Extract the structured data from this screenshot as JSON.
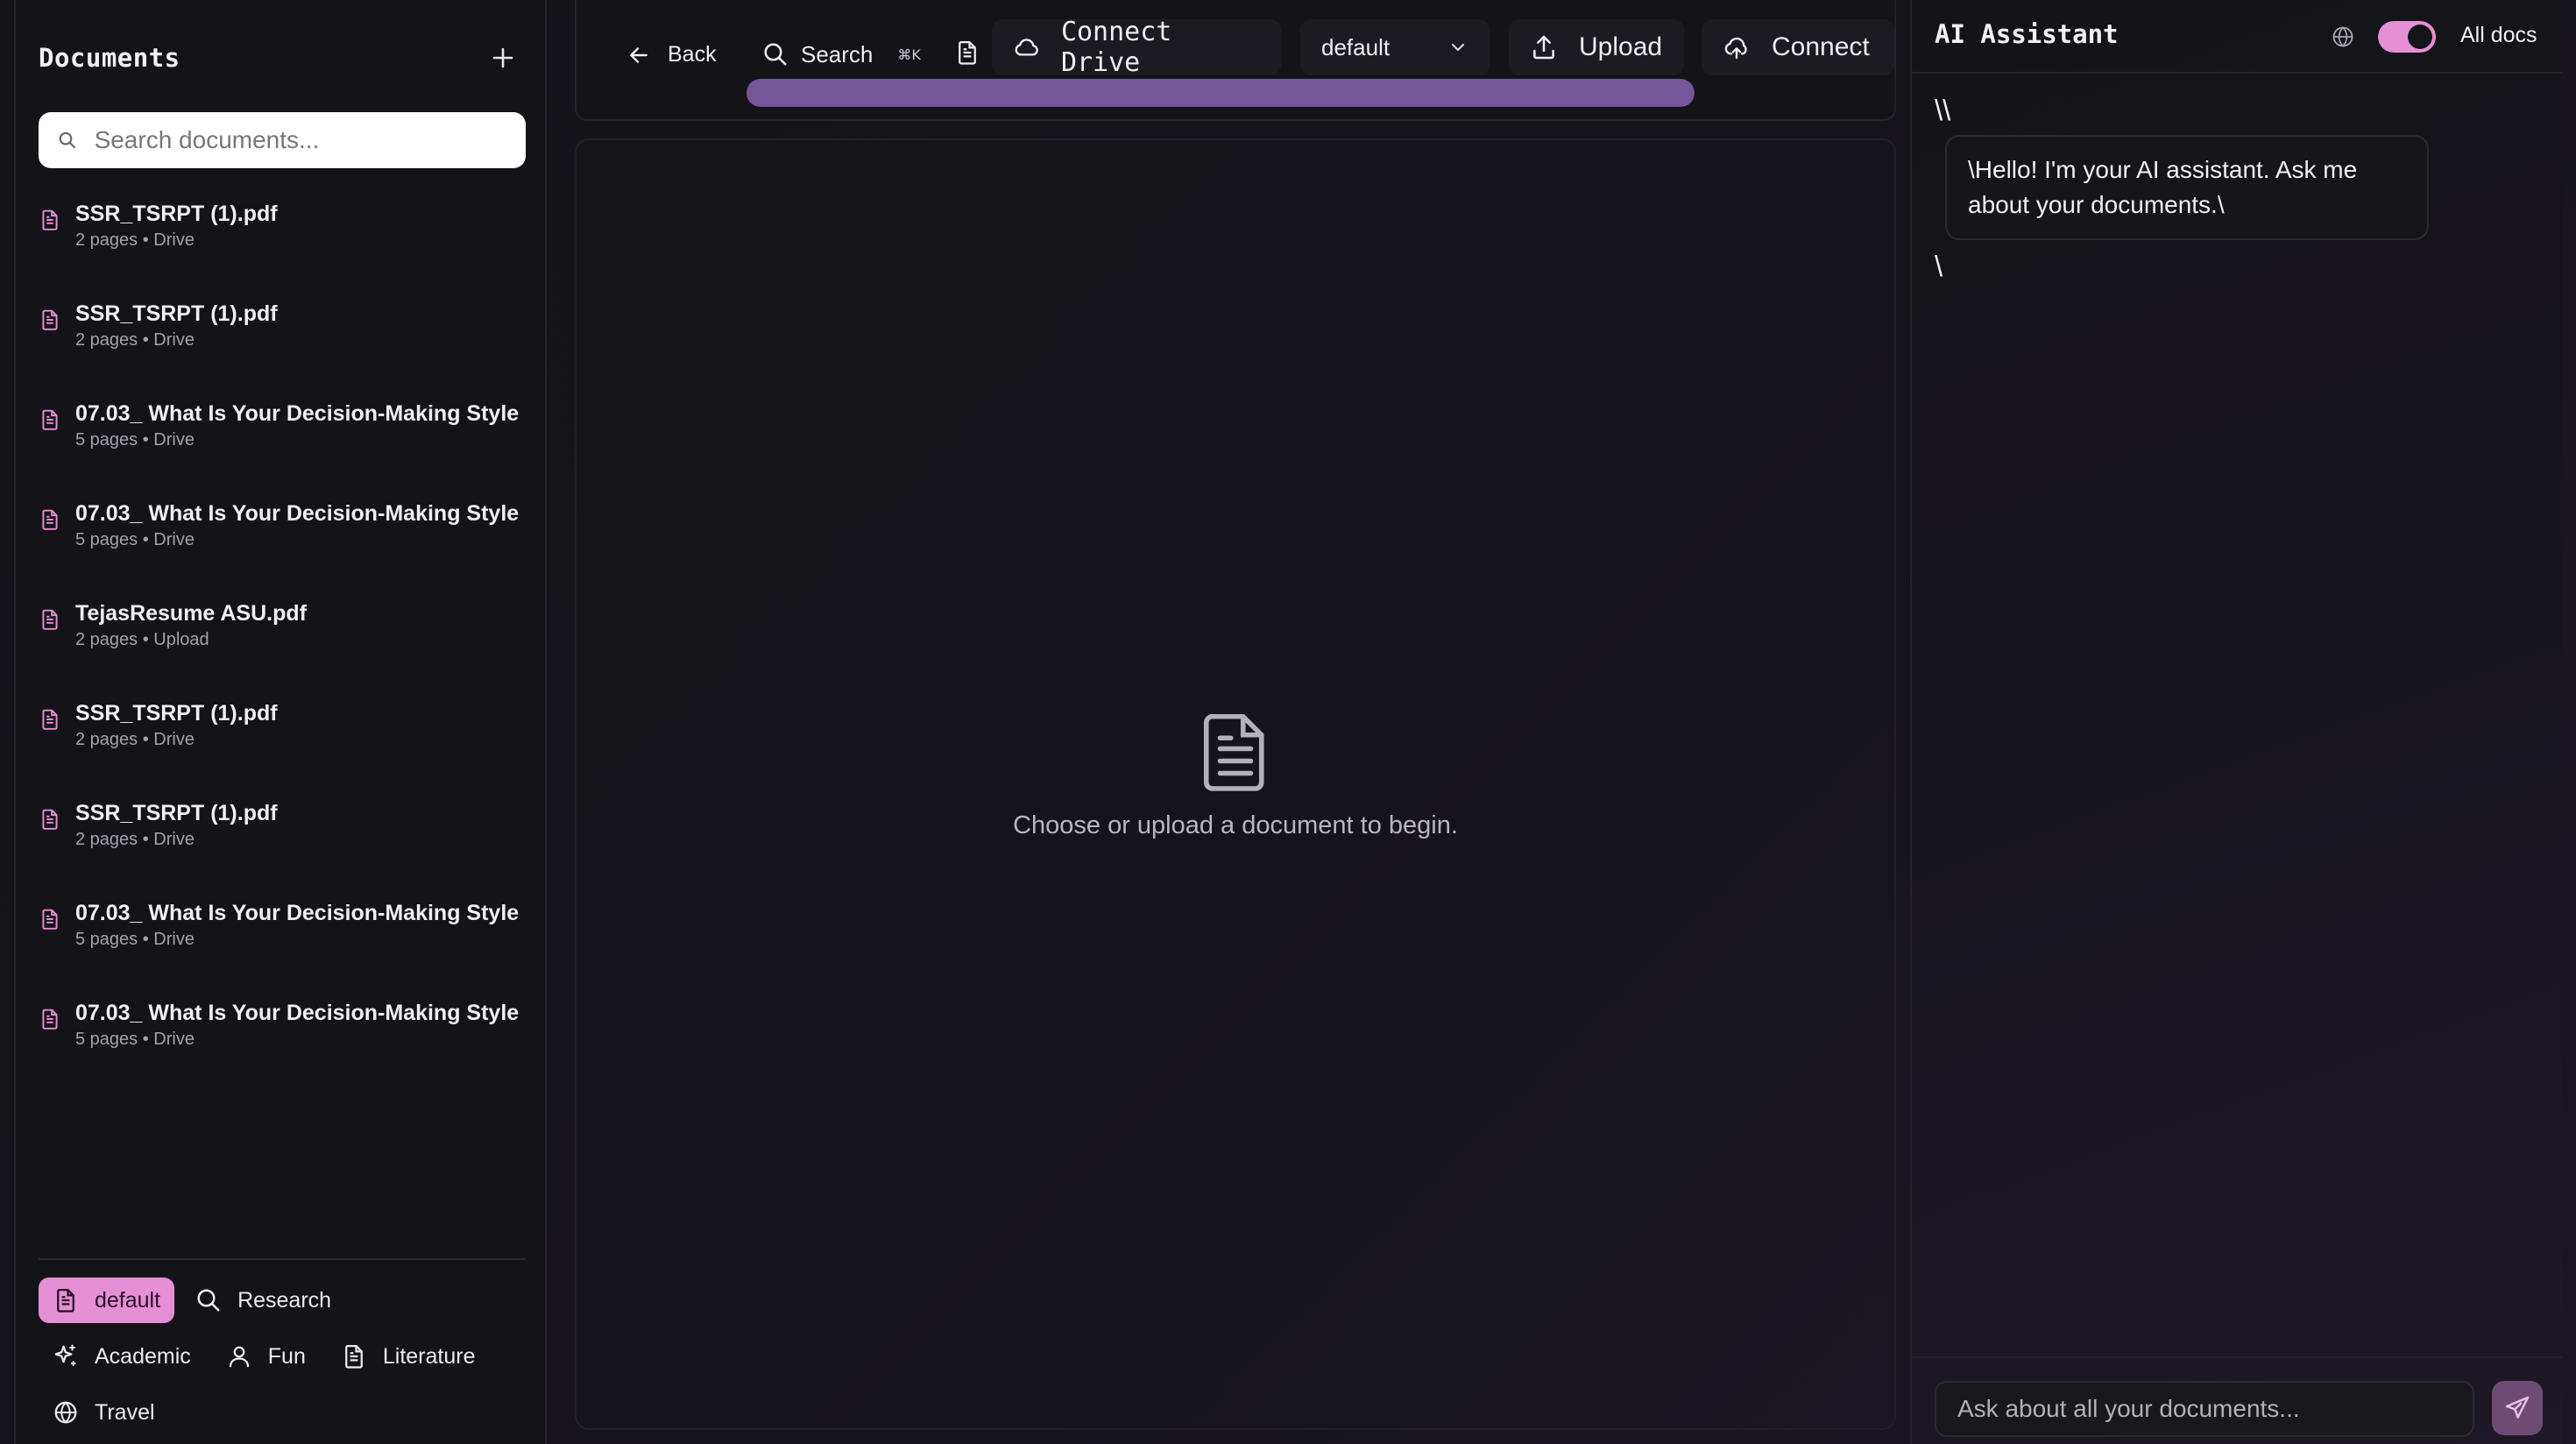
{
  "sidebar": {
    "title": "Documents",
    "search_placeholder": "Search documents...",
    "documents": [
      {
        "name": "SSR_TSRPT (1).pdf",
        "meta": "2 pages • Drive"
      },
      {
        "name": "SSR_TSRPT (1).pdf",
        "meta": "2 pages • Drive"
      },
      {
        "name": "07.03_ What Is Your Decision-Making Style",
        "meta": "5 pages • Drive"
      },
      {
        "name": "07.03_ What Is Your Decision-Making Style",
        "meta": "5 pages • Drive"
      },
      {
        "name": "TejasResume ASU.pdf",
        "meta": "2 pages • Upload"
      },
      {
        "name": "SSR_TSRPT (1).pdf",
        "meta": "2 pages • Drive"
      },
      {
        "name": "SSR_TSRPT (1).pdf",
        "meta": "2 pages • Drive"
      },
      {
        "name": "07.03_ What Is Your Decision-Making Style",
        "meta": "5 pages • Drive"
      },
      {
        "name": "07.03_ What Is Your Decision-Making Style",
        "meta": "5 pages • Drive"
      }
    ],
    "collections": [
      {
        "label": "default",
        "icon": "document-icon",
        "active": true
      },
      {
        "label": "Research",
        "icon": "search-icon"
      },
      {
        "label": "Academic",
        "icon": "sparkle-icon"
      },
      {
        "label": "Fun",
        "icon": "user-icon"
      },
      {
        "label": "Literature",
        "icon": "document-icon"
      },
      {
        "label": "Travel",
        "icon": "globe-icon"
      }
    ]
  },
  "toolbar": {
    "back_label": "Back",
    "search_label": "Search",
    "search_shortcut": "⌘K",
    "connect_drive_label": "Connect Drive",
    "collection_selected": "default",
    "upload_label": "Upload",
    "connect_label": "Connect"
  },
  "main": {
    "empty_message": "Choose or upload a document to begin."
  },
  "assistant": {
    "title": "AI Assistant",
    "toggle_label": "All docs",
    "toggle_on": true,
    "chat_prefix": "\\\\",
    "message": "\\Hello! I'm your AI assistant. Ask me about your documents.\\",
    "chat_suffix": "\\",
    "input_placeholder": "Ask about all your documents..."
  },
  "colors": {
    "accent": "#e58fd6",
    "progress": "#7a5aa0",
    "send_button": "#6d4c74",
    "background": "#141318"
  }
}
